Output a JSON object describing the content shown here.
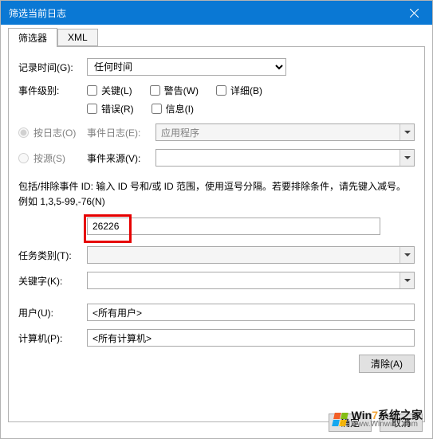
{
  "window": {
    "title": "筛选当前日志"
  },
  "tabs": {
    "filter": "筛选器",
    "xml": "XML"
  },
  "labels": {
    "logTime": "记录时间(G):",
    "eventLevel": "事件级别:",
    "byLog": "按日志(O)",
    "bySource": "按源(S)",
    "eventLog": "事件日志(E):",
    "eventSource": "事件来源(V):",
    "desc": "包括/排除事件 ID: 输入 ID 号和/或 ID 范围，使用逗号分隔。若要排除条件，请先键入减号。例如 1,3,5-99,-76(N)",
    "taskCategory": "任务类别(T):",
    "keywords": "关键字(K):",
    "user": "用户(U):",
    "computer": "计算机(P):"
  },
  "timeOptions": {
    "selected": "任何时间"
  },
  "levels": {
    "critical": "关键(L)",
    "warning": "警告(W)",
    "verbose": "详细(B)",
    "error": "错误(R)",
    "info": "信息(I)"
  },
  "eventLogValue": "应用程序",
  "eventSourceValue": "",
  "idValue": "26226",
  "taskCategoryValue": "",
  "keywordsValue": "",
  "userValue": "<所有用户>",
  "computerValue": "<所有计算机>",
  "buttons": {
    "clear": "清除(A)",
    "ok": "确定",
    "cancel": "取消"
  },
  "watermark": {
    "brand_pre": "Win",
    "brand_seven": "7",
    "brand_post": "系统之家",
    "url": "www.Winwin7.com"
  }
}
